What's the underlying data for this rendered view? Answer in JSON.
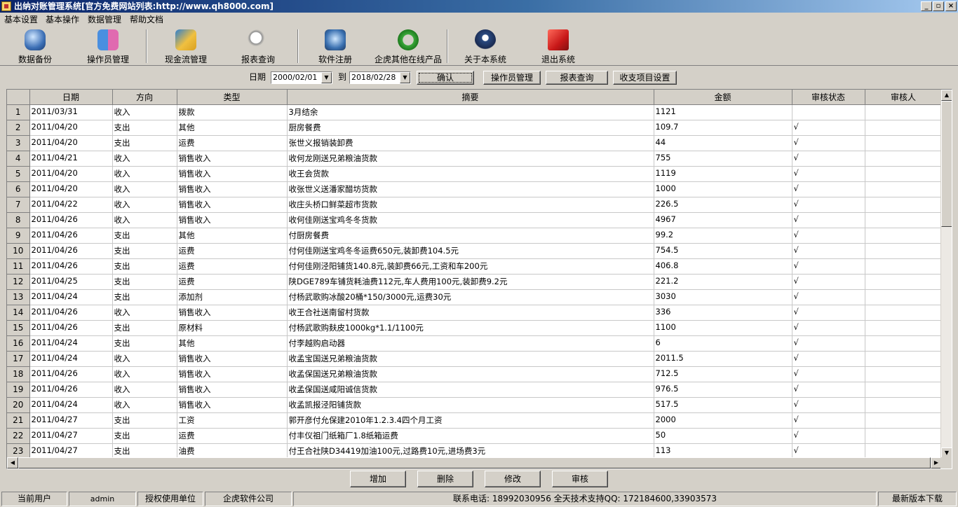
{
  "window": {
    "title": "出纳对账管理系统[官方免费网站列表:http://www.qh8000.com]"
  },
  "menu": [
    "基本设置",
    "基本操作",
    "数据管理",
    "帮助文档"
  ],
  "toolbar": [
    {
      "label": "数据备份",
      "icon": "database-icon"
    },
    {
      "label": "操作员管理",
      "icon": "operator-icon"
    },
    {
      "label": "现金流管理",
      "icon": "cashflow-icon"
    },
    {
      "label": "报表查询",
      "icon": "magnifier-icon"
    },
    {
      "label": "软件注册",
      "icon": "register-icon"
    },
    {
      "label": "企虎其他在线产品",
      "icon": "refresh-icon"
    },
    {
      "label": "关于本系统",
      "icon": "mascot-icon"
    },
    {
      "label": "退出系统",
      "icon": "exit-icon"
    }
  ],
  "filter": {
    "date_label": "日期",
    "start_date": "2000/02/01",
    "to_label": "到",
    "end_date": "2018/02/28",
    "confirm": "确认",
    "operator_mgmt": "操作员管理",
    "report_query": "报表查询",
    "item_settings": "收支项目设置"
  },
  "table": {
    "columns": [
      "日期",
      "方向",
      "类型",
      "摘要",
      "金额",
      "审核状态",
      "审核人"
    ],
    "rows": [
      [
        "2011/03/31",
        "收入",
        "拨款",
        "3月结余",
        "1121",
        "",
        ""
      ],
      [
        "2011/04/20",
        "支出",
        "其他",
        "厨房餐费",
        "109.7",
        "√",
        ""
      ],
      [
        "2011/04/20",
        "支出",
        "运费",
        "张世义报销装卸费",
        "44",
        "√",
        ""
      ],
      [
        "2011/04/21",
        "收入",
        "销售收入",
        "收何龙刚送兄弟粮油货款",
        "755",
        "√",
        ""
      ],
      [
        "2011/04/20",
        "收入",
        "销售收入",
        "收王会货款",
        "1119",
        "√",
        ""
      ],
      [
        "2011/04/20",
        "收入",
        "销售收入",
        "收张世义送潘家醋坊货款",
        "1000",
        "√",
        ""
      ],
      [
        "2011/04/22",
        "收入",
        "销售收入",
        "收庄头桥口鲜菜超市货款",
        "226.5",
        "√",
        ""
      ],
      [
        "2011/04/26",
        "收入",
        "销售收入",
        "收何佳刚送宝鸡冬冬货款",
        "4967",
        "√",
        ""
      ],
      [
        "2011/04/26",
        "支出",
        "其他",
        "付厨房餐费",
        "99.2",
        "√",
        ""
      ],
      [
        "2011/04/26",
        "支出",
        "运费",
        "付何佳刚送宝鸡冬冬运费650元,装卸费104.5元",
        "754.5",
        "√",
        ""
      ],
      [
        "2011/04/26",
        "支出",
        "运费",
        "付何佳刚泾阳铺货140.8元,装卸费66元,工资和车200元",
        "406.8",
        "√",
        ""
      ],
      [
        "2011/04/25",
        "支出",
        "运费",
        "陕DGE789车铺货耗油费112元,车人费用100元,装卸费9.2元",
        "221.2",
        "√",
        ""
      ],
      [
        "2011/04/24",
        "支出",
        "添加剂",
        "付杨武歌购冰酸20桶*150/3000元,运费30元",
        "3030",
        "√",
        ""
      ],
      [
        "2011/04/26",
        "收入",
        "销售收入",
        "收王合社送南留村货款",
        "336",
        "√",
        ""
      ],
      [
        "2011/04/26",
        "支出",
        "原材料",
        "付杨武歌购麸皮1000kg*1.1/1100元",
        "1100",
        "√",
        ""
      ],
      [
        "2011/04/24",
        "支出",
        "其他",
        "付李越购启动器",
        "6",
        "√",
        ""
      ],
      [
        "2011/04/24",
        "收入",
        "销售收入",
        "收孟宝国送兄弟粮油货款",
        "2011.5",
        "√",
        ""
      ],
      [
        "2011/04/26",
        "收入",
        "销售收入",
        "收孟保国送兄弟粮油货款",
        "712.5",
        "√",
        ""
      ],
      [
        "2011/04/26",
        "收入",
        "销售收入",
        "收孟保国送咸阳诚信货款",
        "976.5",
        "√",
        ""
      ],
      [
        "2011/04/24",
        "收入",
        "销售收入",
        "收孟凯报泾阳铺货款",
        "517.5",
        "√",
        ""
      ],
      [
        "2011/04/27",
        "支出",
        "工资",
        "郭开彦付允保建2010年1.2.3.4四个月工资",
        "2000",
        "√",
        ""
      ],
      [
        "2011/04/27",
        "支出",
        "运费",
        "付丰仪祖门纸箱厂1.8纸箱运费",
        "50",
        "√",
        ""
      ],
      [
        "2011/04/27",
        "支出",
        "油费",
        "付王合社陕D34419加油100元,过路费10元,进场费3元",
        "113",
        "√",
        ""
      ]
    ]
  },
  "actions": [
    "增加",
    "删除",
    "修改",
    "审核"
  ],
  "status": {
    "current_user_label": "当前用户",
    "current_user": "admin",
    "licensee_label": "授权使用单位",
    "licensee": "企虎软件公司",
    "contact": "联系电话: 18992030956   全天技术支持QQ: 172184600,33903573",
    "download": "最新版本下载"
  }
}
